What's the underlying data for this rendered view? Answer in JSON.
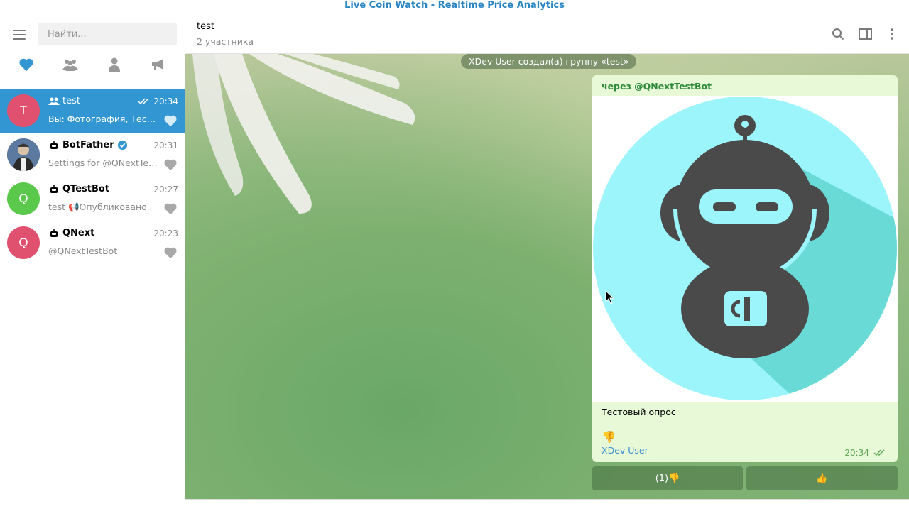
{
  "window": {
    "title": "Live Coin Watch - Realtime Price Analytics"
  },
  "sidebar": {
    "search_placeholder": "Найти...",
    "filters": [
      {
        "icon": "heart-icon",
        "active": true
      },
      {
        "icon": "groups-icon",
        "active": false
      },
      {
        "icon": "person-icon",
        "active": false
      },
      {
        "icon": "megaphone-icon",
        "active": false
      }
    ],
    "chats": [
      {
        "name": "test",
        "time": "20:34",
        "preview": "Вы: Фотография, Тестовый опрос",
        "avatar_letter": "T",
        "avatar_color": "#e0506f",
        "type": "group",
        "active": true,
        "read": true
      },
      {
        "name": "BotFather",
        "time": "20:31",
        "preview": "Settings for @QNextTestBot",
        "avatar_letter": "",
        "avatar_color": "#7a8a9a",
        "type": "bot",
        "verified": true
      },
      {
        "name": "QTestBot",
        "time": "20:27",
        "preview": "test 📢Опубликовано",
        "avatar_letter": "Q",
        "avatar_color": "#5ac84b",
        "type": "bot"
      },
      {
        "name": "QNext",
        "time": "20:23",
        "preview": "@QNextTestBot",
        "avatar_letter": "Q",
        "avatar_color": "#e0506f",
        "type": "bot"
      }
    ]
  },
  "header": {
    "title": "test",
    "subtitle": "2 участника"
  },
  "conversation": {
    "service_message": "XDev User создал(а) группу «test»",
    "message": {
      "via": "через @QNextTestBot",
      "caption": "Тестовый опрос",
      "reaction_emoji": "👎",
      "reaction_user": "XDev User",
      "time": "20:34",
      "bubble_color": "#e7f9d6",
      "photo_bg": "#9bf5fb",
      "robot_color": "#4a4a4a"
    },
    "buttons": [
      {
        "label": "(1)👎"
      },
      {
        "label": "👍"
      }
    ]
  },
  "accent_color": "#3196d1"
}
